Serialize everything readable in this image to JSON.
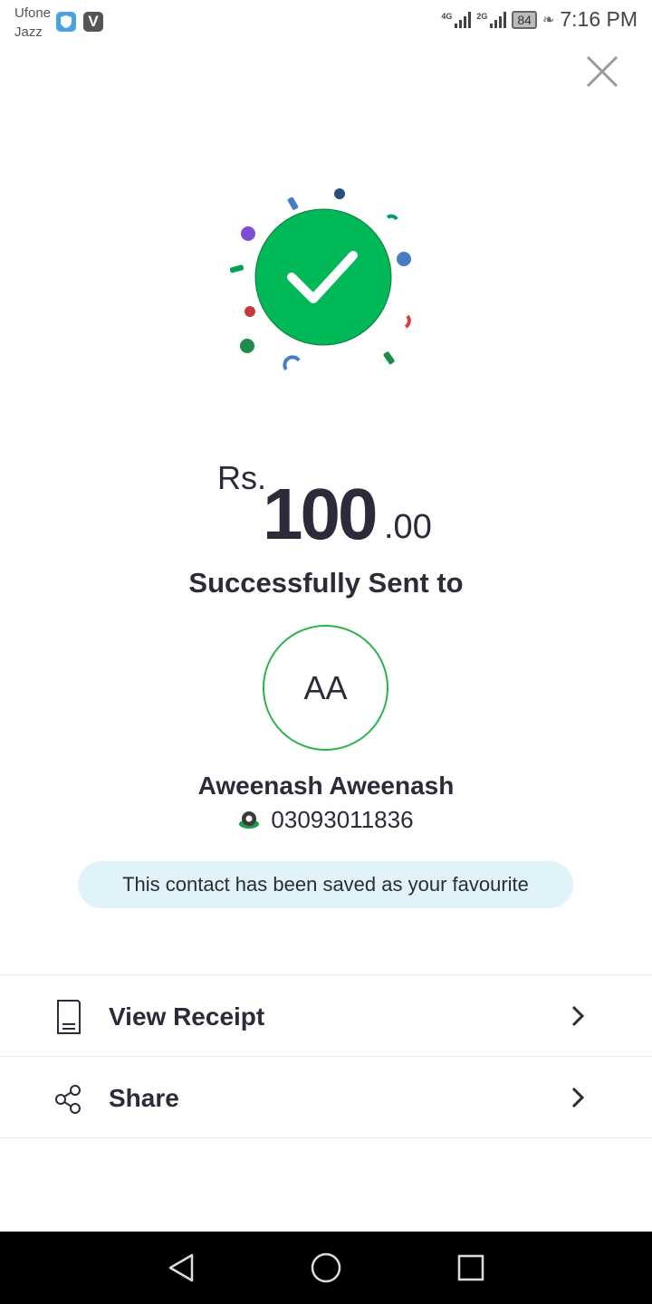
{
  "status_bar": {
    "carrier_1": "Ufone",
    "carrier_2": "Jazz",
    "network_1": "4G",
    "network_2": "2G",
    "battery": "84",
    "time": "7:16 PM"
  },
  "close_icon": "close-icon",
  "success_icon": "check-circle-icon",
  "accent_color": "#00b857",
  "amount": {
    "currency": "Rs.",
    "whole": "100",
    "decimal": ".00"
  },
  "status_message": "Successfully Sent to",
  "recipient": {
    "initials": "AA",
    "name": "Aweenash Aweenash",
    "phone": "03093011836"
  },
  "favourite_notice": "This contact has been saved as your favourite",
  "actions": [
    {
      "label": "View Receipt",
      "icon": "receipt-icon"
    },
    {
      "label": "Share",
      "icon": "share-icon"
    }
  ],
  "nav": [
    "back-icon",
    "home-icon",
    "recents-icon"
  ]
}
